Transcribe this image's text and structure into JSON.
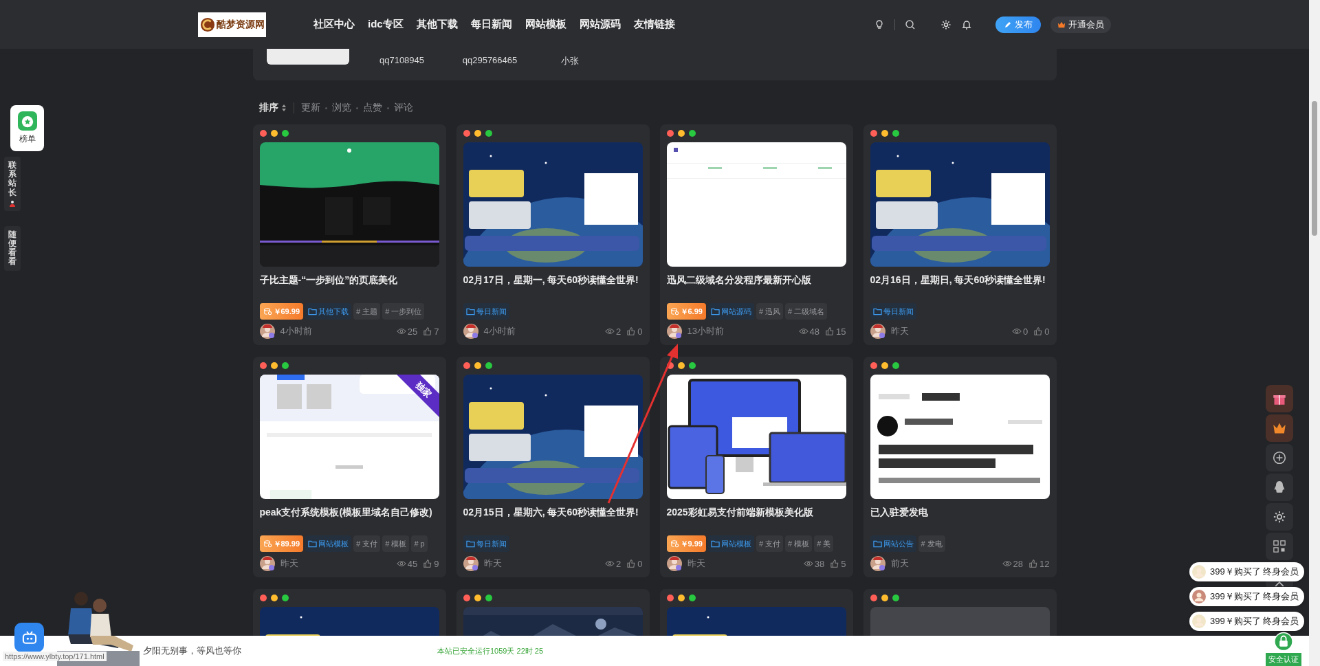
{
  "header": {
    "logo_text": "酷梦资源网",
    "nav": [
      "社区中心",
      "idc专区",
      "其他下载",
      "每日新闻",
      "网站模板",
      "网站源码",
      "友情链接"
    ],
    "publish_button": "发布",
    "vip_button": "开通会员"
  },
  "user_strip": {
    "users": [
      "qq7108945",
      "qq295766465",
      "小张"
    ]
  },
  "sort_bar": {
    "label": "排序",
    "options": [
      "更新",
      "浏览",
      "点赞",
      "评论"
    ]
  },
  "left_float": {
    "rank_button": "榜单",
    "tabs": [
      "联系站长",
      "随便看看"
    ]
  },
  "posts": [
    {
      "title": "子比主题-“一步到位”的页底美化",
      "price": "￥69.99",
      "category": "其他下载",
      "tags": [
        "# 主题",
        "# 一步到位"
      ],
      "time": "4小时前",
      "views": "25",
      "likes": "7"
    },
    {
      "title": "02月17日，星期一, 每天60秒读懂全世界!",
      "category": "每日新闻",
      "time": "4小时前",
      "views": "2",
      "likes": "0"
    },
    {
      "title": "迅风二级域名分发程序最新开心版",
      "price": "￥6.99",
      "category": "网站源码",
      "tags": [
        "# 迅风",
        "# 二级域名"
      ],
      "time": "13小时前",
      "views": "48",
      "likes": "15"
    },
    {
      "title": "02月16日，星期日, 每天60秒读懂全世界!",
      "category": "每日新闻",
      "time": "昨天",
      "views": "0",
      "likes": "0"
    },
    {
      "title": "peak支付系统模板(模板里域名自己修改)",
      "price": "￥89.99",
      "category": "网站模板",
      "tags": [
        "# 支付",
        "# 模板",
        "# p"
      ],
      "badge": "独家",
      "time": "昨天",
      "views": "45",
      "likes": "9"
    },
    {
      "title": "02月15日，星期六, 每天60秒读懂全世界!",
      "category": "每日新闻",
      "time": "昨天",
      "views": "2",
      "likes": "0"
    },
    {
      "title": "2025彩虹易支付前端新模板美化版",
      "price": "￥9.99",
      "category": "网站模板",
      "tags": [
        "# 支付",
        "# 模板",
        "# 美"
      ],
      "time": "昨天",
      "views": "38",
      "likes": "5"
    },
    {
      "title": "已入驻爱发电",
      "category": "网站公告",
      "tags": [
        "# 发电"
      ],
      "time": "前天",
      "views": "28",
      "likes": "12"
    }
  ],
  "more_posts": [
    {
      "kind": "picture"
    },
    {
      "kind": "picture"
    },
    {
      "kind": "picture"
    },
    {
      "kind": "placeholder"
    }
  ],
  "purchase_toasts": [
    "399￥购买了 终身会员",
    "399￥购买了 终身会员",
    "399￥购买了 终身会员"
  ],
  "footer": {
    "status_url": "https://www.ylbty.top/171.html",
    "motto": "夕阳无别事，等风也等你",
    "uptime": "本站已安全运行1059天 22时 25",
    "security_badge": "安全认证"
  }
}
